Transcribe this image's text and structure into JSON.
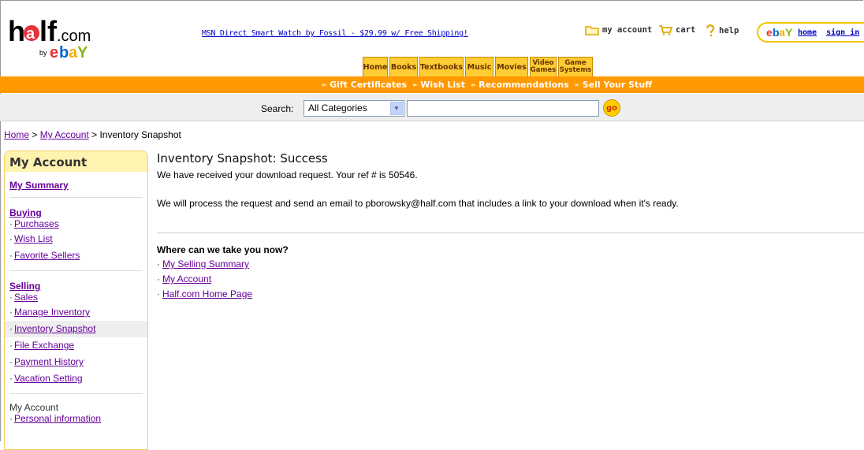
{
  "header": {
    "logo_text": "half.com by eBay",
    "promo_link": "MSN Direct Smart Watch by Fossil - $29.99 w/ Free Shipping!",
    "util_links": [
      {
        "label": "my account",
        "icon": "folder-icon"
      },
      {
        "label": "cart",
        "icon": "cart-icon"
      },
      {
        "label": "help",
        "icon": "help-icon"
      }
    ],
    "ebay": {
      "logo": "ebay-logo",
      "home": "home",
      "signin": "sign in"
    }
  },
  "tabs": [
    {
      "label": "Home"
    },
    {
      "label": "Books"
    },
    {
      "label": "Textbooks"
    },
    {
      "label": "Music"
    },
    {
      "label": "Movies"
    },
    {
      "line1": "Video",
      "line2": "Games"
    },
    {
      "line1": "Game",
      "line2": "Systems"
    }
  ],
  "subnav": [
    "Gift Certificates",
    "Wish List",
    "Recommendations",
    "Sell Your Stuff"
  ],
  "search": {
    "label": "Search:",
    "category": "All Categories",
    "go_label": "go",
    "value": ""
  },
  "breadcrumb": {
    "home": "Home",
    "sep1": ">",
    "account": "My Account",
    "sep2": ">",
    "current": "Inventory Snapshot"
  },
  "sidebar": {
    "title": "My Account",
    "summary": "My Summary",
    "buying": {
      "title": "Buying",
      "items": [
        "Purchases",
        "Wish List",
        "Favorite Sellers"
      ]
    },
    "selling": {
      "title": "Selling",
      "items": [
        "Sales",
        "Manage Inventory",
        "Inventory Snapshot",
        "File Exchange",
        "Payment History",
        "Vacation Setting"
      ]
    },
    "myaccount": {
      "title": "My Account",
      "items": [
        "Personal information"
      ]
    }
  },
  "main": {
    "title": "Inventory Snapshot: Success",
    "line1": "We have received your download request. Your ref # is 50546.",
    "line2": "We will process the request and send an email to pborowsky@half.com that includes a link to your download when it's ready.",
    "where_title": "Where can we take you now?",
    "links": [
      "My Selling Summary",
      "My Account",
      "Half.com Home Page"
    ]
  },
  "colors": {
    "orange": "#ff9900",
    "tab_yellow": "#ffcc33",
    "link_purple": "#660099",
    "link_blue": "#0000cc"
  }
}
